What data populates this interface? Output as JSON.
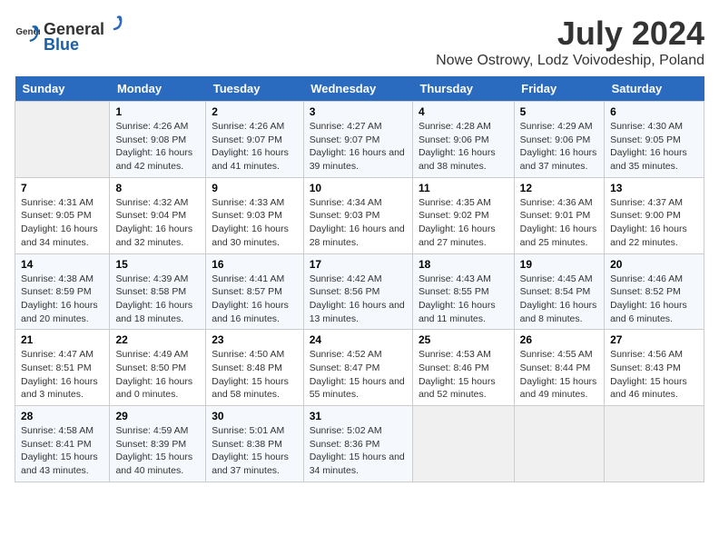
{
  "logo": {
    "general": "General",
    "blue": "Blue"
  },
  "title": "July 2024",
  "subtitle": "Nowe Ostrowy, Lodz Voivodeship, Poland",
  "days_header": [
    "Sunday",
    "Monday",
    "Tuesday",
    "Wednesday",
    "Thursday",
    "Friday",
    "Saturday"
  ],
  "weeks": [
    [
      {
        "day": "",
        "content": ""
      },
      {
        "day": "1",
        "content": "Sunrise: 4:26 AM\nSunset: 9:08 PM\nDaylight: 16 hours and 42 minutes."
      },
      {
        "day": "2",
        "content": "Sunrise: 4:26 AM\nSunset: 9:07 PM\nDaylight: 16 hours and 41 minutes."
      },
      {
        "day": "3",
        "content": "Sunrise: 4:27 AM\nSunset: 9:07 PM\nDaylight: 16 hours and 39 minutes."
      },
      {
        "day": "4",
        "content": "Sunrise: 4:28 AM\nSunset: 9:06 PM\nDaylight: 16 hours and 38 minutes."
      },
      {
        "day": "5",
        "content": "Sunrise: 4:29 AM\nSunset: 9:06 PM\nDaylight: 16 hours and 37 minutes."
      },
      {
        "day": "6",
        "content": "Sunrise: 4:30 AM\nSunset: 9:05 PM\nDaylight: 16 hours and 35 minutes."
      }
    ],
    [
      {
        "day": "7",
        "content": "Sunrise: 4:31 AM\nSunset: 9:05 PM\nDaylight: 16 hours and 34 minutes."
      },
      {
        "day": "8",
        "content": "Sunrise: 4:32 AM\nSunset: 9:04 PM\nDaylight: 16 hours and 32 minutes."
      },
      {
        "day": "9",
        "content": "Sunrise: 4:33 AM\nSunset: 9:03 PM\nDaylight: 16 hours and 30 minutes."
      },
      {
        "day": "10",
        "content": "Sunrise: 4:34 AM\nSunset: 9:03 PM\nDaylight: 16 hours and 28 minutes."
      },
      {
        "day": "11",
        "content": "Sunrise: 4:35 AM\nSunset: 9:02 PM\nDaylight: 16 hours and 27 minutes."
      },
      {
        "day": "12",
        "content": "Sunrise: 4:36 AM\nSunset: 9:01 PM\nDaylight: 16 hours and 25 minutes."
      },
      {
        "day": "13",
        "content": "Sunrise: 4:37 AM\nSunset: 9:00 PM\nDaylight: 16 hours and 22 minutes."
      }
    ],
    [
      {
        "day": "14",
        "content": "Sunrise: 4:38 AM\nSunset: 8:59 PM\nDaylight: 16 hours and 20 minutes."
      },
      {
        "day": "15",
        "content": "Sunrise: 4:39 AM\nSunset: 8:58 PM\nDaylight: 16 hours and 18 minutes."
      },
      {
        "day": "16",
        "content": "Sunrise: 4:41 AM\nSunset: 8:57 PM\nDaylight: 16 hours and 16 minutes."
      },
      {
        "day": "17",
        "content": "Sunrise: 4:42 AM\nSunset: 8:56 PM\nDaylight: 16 hours and 13 minutes."
      },
      {
        "day": "18",
        "content": "Sunrise: 4:43 AM\nSunset: 8:55 PM\nDaylight: 16 hours and 11 minutes."
      },
      {
        "day": "19",
        "content": "Sunrise: 4:45 AM\nSunset: 8:54 PM\nDaylight: 16 hours and 8 minutes."
      },
      {
        "day": "20",
        "content": "Sunrise: 4:46 AM\nSunset: 8:52 PM\nDaylight: 16 hours and 6 minutes."
      }
    ],
    [
      {
        "day": "21",
        "content": "Sunrise: 4:47 AM\nSunset: 8:51 PM\nDaylight: 16 hours and 3 minutes."
      },
      {
        "day": "22",
        "content": "Sunrise: 4:49 AM\nSunset: 8:50 PM\nDaylight: 16 hours and 0 minutes."
      },
      {
        "day": "23",
        "content": "Sunrise: 4:50 AM\nSunset: 8:48 PM\nDaylight: 15 hours and 58 minutes."
      },
      {
        "day": "24",
        "content": "Sunrise: 4:52 AM\nSunset: 8:47 PM\nDaylight: 15 hours and 55 minutes."
      },
      {
        "day": "25",
        "content": "Sunrise: 4:53 AM\nSunset: 8:46 PM\nDaylight: 15 hours and 52 minutes."
      },
      {
        "day": "26",
        "content": "Sunrise: 4:55 AM\nSunset: 8:44 PM\nDaylight: 15 hours and 49 minutes."
      },
      {
        "day": "27",
        "content": "Sunrise: 4:56 AM\nSunset: 8:43 PM\nDaylight: 15 hours and 46 minutes."
      }
    ],
    [
      {
        "day": "28",
        "content": "Sunrise: 4:58 AM\nSunset: 8:41 PM\nDaylight: 15 hours and 43 minutes."
      },
      {
        "day": "29",
        "content": "Sunrise: 4:59 AM\nSunset: 8:39 PM\nDaylight: 15 hours and 40 minutes."
      },
      {
        "day": "30",
        "content": "Sunrise: 5:01 AM\nSunset: 8:38 PM\nDaylight: 15 hours and 37 minutes."
      },
      {
        "day": "31",
        "content": "Sunrise: 5:02 AM\nSunset: 8:36 PM\nDaylight: 15 hours and 34 minutes."
      },
      {
        "day": "",
        "content": ""
      },
      {
        "day": "",
        "content": ""
      },
      {
        "day": "",
        "content": ""
      }
    ]
  ]
}
